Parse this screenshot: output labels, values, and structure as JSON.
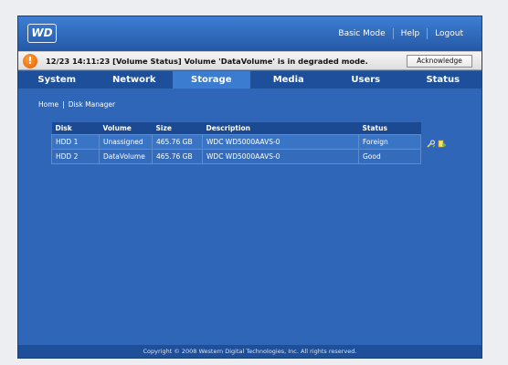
{
  "header": {
    "logo": "WD",
    "links": [
      "Basic Mode",
      "Help",
      "Logout"
    ]
  },
  "alert": {
    "message": "12/23 14:11:23 [Volume Status] Volume 'DataVolume' is in degraded mode.",
    "acknowledge_label": "Acknowledge"
  },
  "nav": {
    "tabs": [
      "System",
      "Network",
      "Storage",
      "Media",
      "Users",
      "Status"
    ],
    "active": "Storage"
  },
  "breadcrumb": [
    "Home",
    "Disk Manager"
  ],
  "table": {
    "headers": [
      "Disk",
      "Volume",
      "Size",
      "Description",
      "Status"
    ],
    "rows": [
      [
        "HDD 1",
        "Unassigned",
        "465.76 GB",
        "WDC WD5000AAVS-0",
        "Foreign"
      ],
      [
        "HDD 2",
        "DataVolume",
        "465.76 GB",
        "WDC WD5000AAVS-0",
        "Good"
      ]
    ],
    "row_action_icons": [
      "repair-icon",
      "format-icon"
    ]
  },
  "footer": {
    "copyright": "Copyright © 2008 Western Digital Technologies, Inc. All rights reserved."
  },
  "colors": {
    "main_bg": "#2f66b7",
    "nav_bg": "#1d4f9a",
    "active_tab": "#3b7bd0",
    "alert_icon": "#e25d00"
  }
}
